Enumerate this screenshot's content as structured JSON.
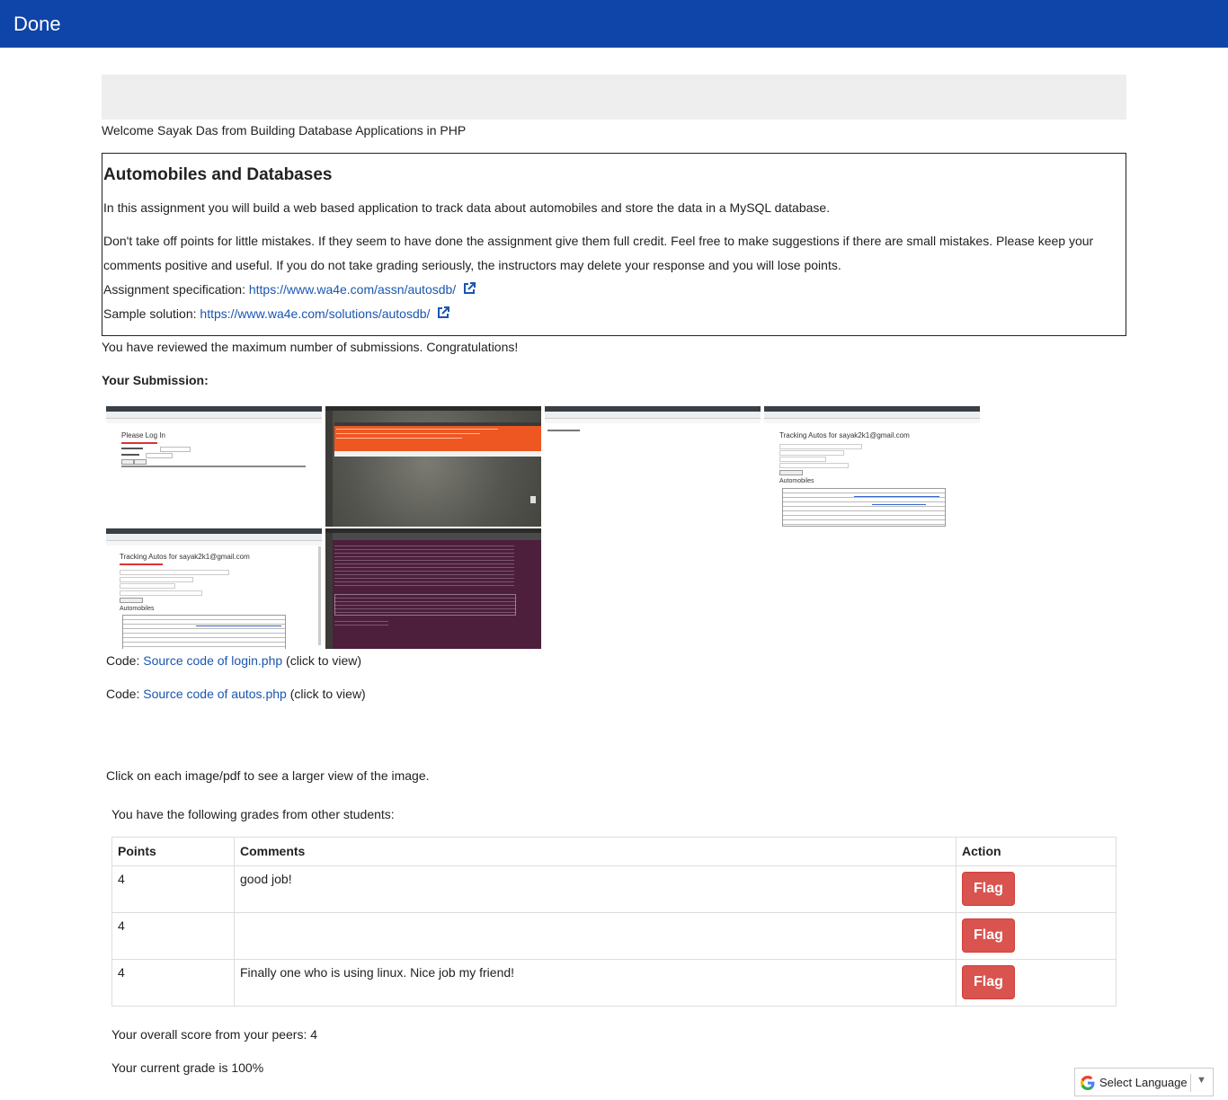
{
  "header": {
    "title": "Done"
  },
  "welcome": "Welcome Sayak Das from Building Database Applications in PHP",
  "assignment": {
    "title": "Automobiles and Databases",
    "intro": "In this assignment you will build a web based application to track data about automobiles and store the data in a MySQL database.",
    "grading_line1": "Don't take off points for little mistakes. If they seem to have done the assignment give them full credit. Feel free to make suggestions if there are small mistakes. Please keep your",
    "grading_line2": "comments positive and useful. If you do not take grading seriously, the instructors may delete your response and you will lose points.",
    "spec_label": "Assignment specification:",
    "spec_url": "https://www.wa4e.com/assn/autosdb/",
    "sample_label": "Sample solution:",
    "sample_url": "https://www.wa4e.com/solutions/autosdb/"
  },
  "reviewed_msg": "You have reviewed the maximum number of submissions. Congratulations!",
  "submission": {
    "heading": "Your Submission:",
    "thumb_texts": {
      "login_title": "Please Log In",
      "tracking_title": "Tracking Autos for sayak2k1@gmail.com",
      "automobiles": "Automobiles"
    },
    "code1_prefix": "Code:",
    "code1_link": "Source code of login.php",
    "code1_suffix": "(click to view)",
    "code2_prefix": "Code:",
    "code2_link": "Source code of autos.php",
    "code2_suffix": "(click to view)",
    "click_note": "Click on each image/pdf to see a larger view of the image."
  },
  "grades": {
    "intro": "You have the following grades from other students:",
    "headers": {
      "points": "Points",
      "comments": "Comments",
      "action": "Action"
    },
    "rows": [
      {
        "points": "4",
        "comment": "good job!",
        "action": "Flag"
      },
      {
        "points": "4",
        "comment": "",
        "action": "Flag"
      },
      {
        "points": "4",
        "comment": "Finally one who is using linux. Nice job my friend!",
        "action": "Flag"
      }
    ]
  },
  "overall": "Your overall score from your peers: 4",
  "current": "Your current grade is 100%",
  "language": {
    "label": "Select Language",
    "arrow": "▼"
  },
  "colors": {
    "header_bg": "#0f44a8",
    "link": "#1a56b0",
    "flag_bg": "#d9534f"
  }
}
